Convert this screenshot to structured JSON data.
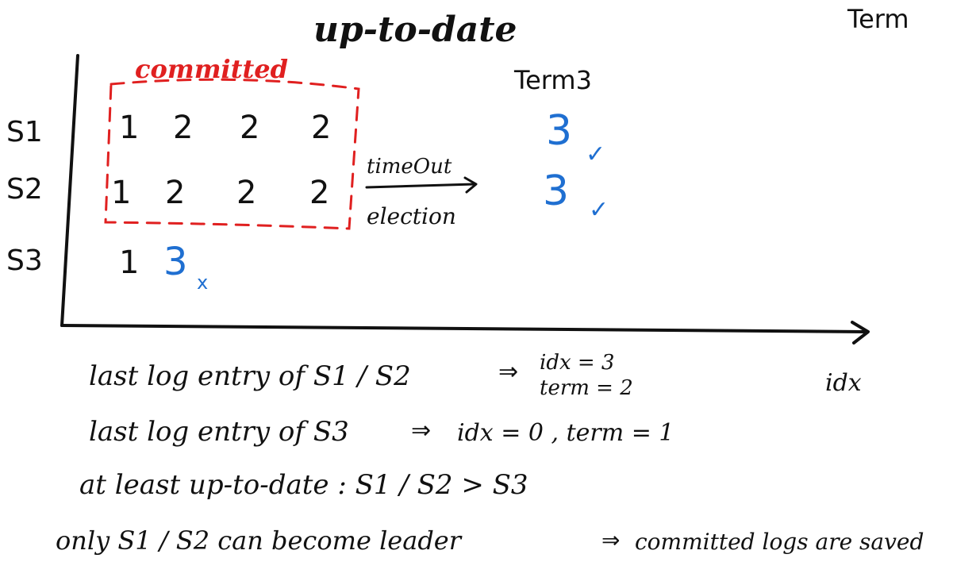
{
  "colors": {
    "ink": "#111111",
    "highlight": "#1f6fd1",
    "box": "#e02020"
  },
  "title": "up-to-date",
  "corner_label": "Term",
  "committed_label": "committed",
  "term_header": "Term3",
  "arrow_label_top": "timeOut",
  "arrow_label_bottom": "election",
  "axis_label": "idx",
  "rows": [
    {
      "server": "S1",
      "entries": [
        "1",
        "2",
        "2",
        "2"
      ]
    },
    {
      "server": "S2",
      "entries": [
        "1",
        "2",
        "2",
        "2"
      ]
    },
    {
      "server": "S3",
      "entries": [
        "1"
      ],
      "new_entry": "3",
      "new_mark": "x"
    }
  ],
  "new_terms": [
    {
      "value": "3",
      "mark": "✓"
    },
    {
      "value": "3",
      "mark": "✓"
    }
  ],
  "notes": {
    "line1_prefix": "last log entry of S1 / S2",
    "line1_arrow": "⇒",
    "line1_idx": "idx = 3",
    "line1_term": "term = 2",
    "line2_prefix": "last log entry of S3",
    "line2_arrow": "⇒",
    "line2_rest": "idx = 0 , term = 1",
    "line3": "at least up-to-date :  S1 / S2 > S3",
    "line4_prefix": "only S1 / S2 can become leader",
    "line4_arrow": "⇒",
    "line4_rest": "committed logs are saved"
  }
}
